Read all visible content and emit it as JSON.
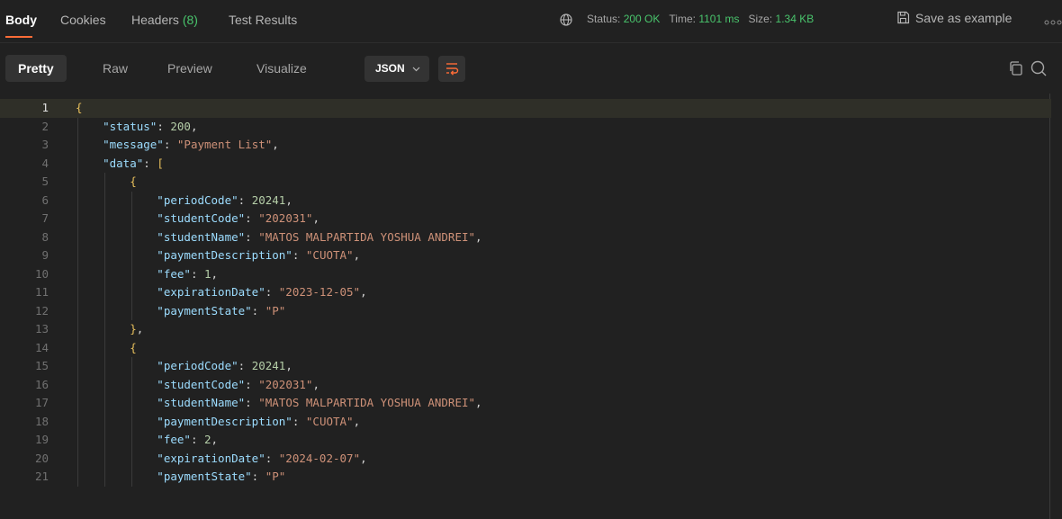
{
  "tabs": {
    "body": "Body",
    "cookies": "Cookies",
    "headers_label": "Headers",
    "headers_count": "(8)",
    "test_results": "Test Results"
  },
  "status": {
    "status_label": "Status:",
    "status_value": "200 OK",
    "time_label": "Time:",
    "time_value": "1101 ms",
    "size_label": "Size:",
    "size_value": "1.34 KB",
    "save_example": "Save as example"
  },
  "toolbar": {
    "pretty": "Pretty",
    "raw": "Raw",
    "preview": "Preview",
    "visualize": "Visualize",
    "format": "JSON"
  },
  "colors": {
    "accent": "#ff6c37",
    "ok": "#49c46c",
    "key": "#9cdcfe",
    "string": "#ce9178",
    "number": "#b5cea8"
  },
  "code_lines": [
    {
      "n": "1",
      "parts": [
        [
          "b",
          "{"
        ]
      ]
    },
    {
      "n": "2",
      "parts": [
        [
          "k",
          "    \"status\""
        ],
        [
          "p",
          ": "
        ],
        [
          "n",
          "200"
        ],
        [
          "p",
          ","
        ]
      ]
    },
    {
      "n": "3",
      "parts": [
        [
          "k",
          "    \"message\""
        ],
        [
          "p",
          ": "
        ],
        [
          "s",
          "\"Payment List\""
        ],
        [
          "p",
          ","
        ]
      ]
    },
    {
      "n": "4",
      "parts": [
        [
          "k",
          "    \"data\""
        ],
        [
          "p",
          ": "
        ],
        [
          "b",
          "["
        ]
      ]
    },
    {
      "n": "5",
      "parts": [
        [
          "b",
          "        {"
        ]
      ]
    },
    {
      "n": "6",
      "parts": [
        [
          "k",
          "            \"periodCode\""
        ],
        [
          "p",
          ": "
        ],
        [
          "n",
          "20241"
        ],
        [
          "p",
          ","
        ]
      ]
    },
    {
      "n": "7",
      "parts": [
        [
          "k",
          "            \"studentCode\""
        ],
        [
          "p",
          ": "
        ],
        [
          "s",
          "\"202031\""
        ],
        [
          "p",
          ","
        ]
      ]
    },
    {
      "n": "8",
      "parts": [
        [
          "k",
          "            \"studentName\""
        ],
        [
          "p",
          ": "
        ],
        [
          "s",
          "\"MATOS MALPARTIDA YOSHUA ANDREI\""
        ],
        [
          "p",
          ","
        ]
      ]
    },
    {
      "n": "9",
      "parts": [
        [
          "k",
          "            \"paymentDescription\""
        ],
        [
          "p",
          ": "
        ],
        [
          "s",
          "\"CUOTA\""
        ],
        [
          "p",
          ","
        ]
      ]
    },
    {
      "n": "10",
      "parts": [
        [
          "k",
          "            \"fee\""
        ],
        [
          "p",
          ": "
        ],
        [
          "n",
          "1"
        ],
        [
          "p",
          ","
        ]
      ]
    },
    {
      "n": "11",
      "parts": [
        [
          "k",
          "            \"expirationDate\""
        ],
        [
          "p",
          ": "
        ],
        [
          "s",
          "\"2023-12-05\""
        ],
        [
          "p",
          ","
        ]
      ]
    },
    {
      "n": "12",
      "parts": [
        [
          "k",
          "            \"paymentState\""
        ],
        [
          "p",
          ": "
        ],
        [
          "s",
          "\"P\""
        ]
      ]
    },
    {
      "n": "13",
      "parts": [
        [
          "b",
          "        }"
        ],
        [
          "p",
          ","
        ]
      ]
    },
    {
      "n": "14",
      "parts": [
        [
          "b",
          "        {"
        ]
      ]
    },
    {
      "n": "15",
      "parts": [
        [
          "k",
          "            \"periodCode\""
        ],
        [
          "p",
          ": "
        ],
        [
          "n",
          "20241"
        ],
        [
          "p",
          ","
        ]
      ]
    },
    {
      "n": "16",
      "parts": [
        [
          "k",
          "            \"studentCode\""
        ],
        [
          "p",
          ": "
        ],
        [
          "s",
          "\"202031\""
        ],
        [
          "p",
          ","
        ]
      ]
    },
    {
      "n": "17",
      "parts": [
        [
          "k",
          "            \"studentName\""
        ],
        [
          "p",
          ": "
        ],
        [
          "s",
          "\"MATOS MALPARTIDA YOSHUA ANDREI\""
        ],
        [
          "p",
          ","
        ]
      ]
    },
    {
      "n": "18",
      "parts": [
        [
          "k",
          "            \"paymentDescription\""
        ],
        [
          "p",
          ": "
        ],
        [
          "s",
          "\"CUOTA\""
        ],
        [
          "p",
          ","
        ]
      ]
    },
    {
      "n": "19",
      "parts": [
        [
          "k",
          "            \"fee\""
        ],
        [
          "p",
          ": "
        ],
        [
          "n",
          "2"
        ],
        [
          "p",
          ","
        ]
      ]
    },
    {
      "n": "20",
      "parts": [
        [
          "k",
          "            \"expirationDate\""
        ],
        [
          "p",
          ": "
        ],
        [
          "s",
          "\"2024-02-07\""
        ],
        [
          "p",
          ","
        ]
      ]
    },
    {
      "n": "21",
      "parts": [
        [
          "k",
          "            \"paymentState\""
        ],
        [
          "p",
          ": "
        ],
        [
          "s",
          "\"P\""
        ]
      ]
    }
  ]
}
